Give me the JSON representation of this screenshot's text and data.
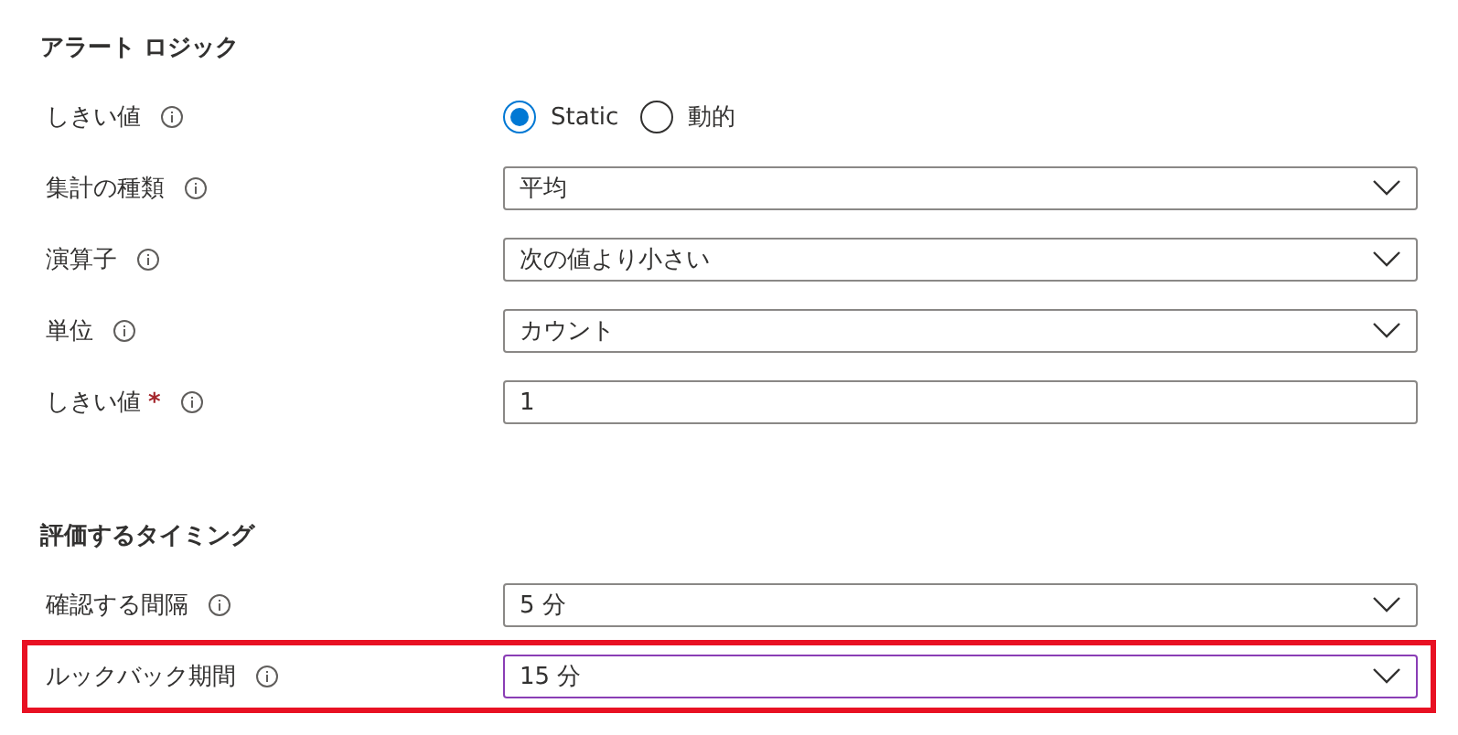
{
  "sections": [
    {
      "title": "アラート ロジック",
      "rows": [
        {
          "label": "しきい値",
          "highlighted": false,
          "kind": "radio",
          "options": [
            {
              "label": "Static",
              "selected": true
            },
            {
              "label": "動的",
              "selected": false
            }
          ]
        },
        {
          "label": "集計の種類",
          "highlighted": false,
          "kind": "dropdown",
          "value": "平均",
          "focused": false
        },
        {
          "label": "演算子",
          "highlighted": false,
          "kind": "dropdown",
          "value": "次の値より小さい",
          "focused": false
        },
        {
          "label": "単位",
          "highlighted": false,
          "kind": "dropdown",
          "value": "カウント",
          "focused": false
        },
        {
          "label": "しきい値",
          "required_mark": "*",
          "highlighted": false,
          "kind": "text",
          "value": "1",
          "focused": false
        }
      ]
    },
    {
      "title": "評価するタイミング",
      "rows": [
        {
          "label": "確認する間隔",
          "highlighted": false,
          "kind": "dropdown",
          "value": "5 分",
          "focused": false
        },
        {
          "label": "ルックバック期間",
          "highlighted": true,
          "kind": "dropdown",
          "value": "15 分",
          "focused": true
        }
      ]
    }
  ]
}
